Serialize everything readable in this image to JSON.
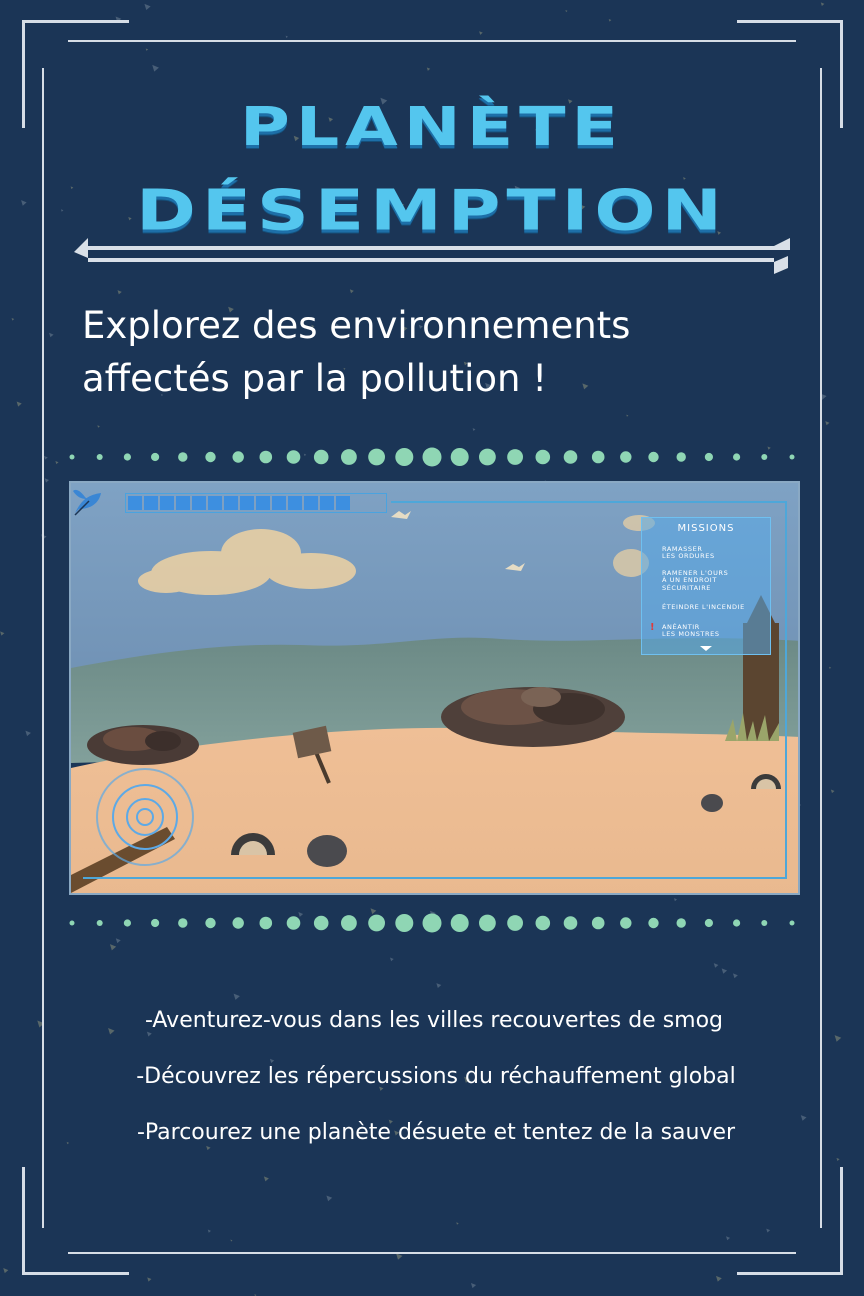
{
  "poster": {
    "title_line1": "PLANÈTE",
    "title_line2": "DÉSEMPTION",
    "tagline_line1": "Explorez des environnements",
    "tagline_line2": "affectés par la pollution !",
    "features": [
      "-Aventurez-vous dans les villes recouvertes de smog",
      "-Découvrez les répercussions du réchauffement global",
      "-Parcourez une planète désuete et tentez de la sauver"
    ]
  },
  "game_hud": {
    "health_fraction": 0.8,
    "missions_title": "MISSIONS",
    "missions": [
      {
        "text": "RAMASSER\nLES ORDURES",
        "alert": false
      },
      {
        "text": "RAMENER L'OURS\nÀ UN ENDROIT\nSÉCURITAIRE",
        "alert": false
      },
      {
        "text": "ÉTEINDRE L'INCENDIE",
        "alert": false
      },
      {
        "text": "ANÉANTIR\nLES MONSTRES",
        "alert": true
      }
    ],
    "alert_symbol": "!"
  },
  "colors": {
    "background": "#1b3556",
    "title_cyan": "#54c6ee",
    "title_shadow": "#1d6fa8",
    "dot_color": "#8fd6b4",
    "hud_blue": "#3d8fe0",
    "frame": "#d6dde6"
  },
  "icons": {
    "leaf": "leaf-icon",
    "joystick": "joystick-icon",
    "chevron": "chevron-down-icon"
  }
}
